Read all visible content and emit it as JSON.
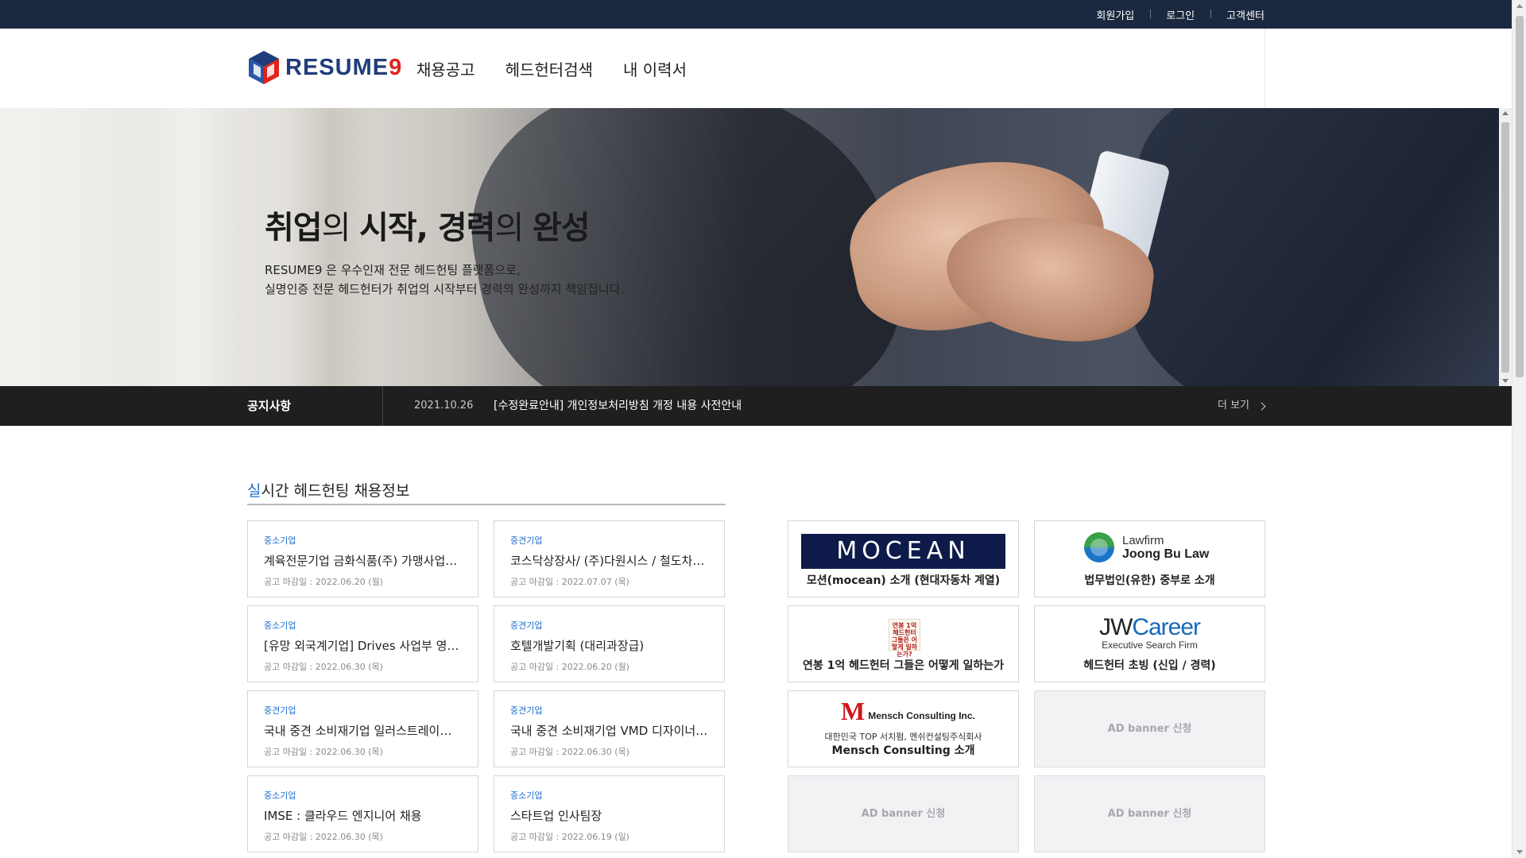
{
  "top_links": [
    "회원가입",
    "로그인",
    "고객센터"
  ],
  "logo": {
    "main": "RESUME",
    "suffix": "9"
  },
  "nav": [
    "채용공고",
    "헤드헌터검색",
    "내 이력서"
  ],
  "hero": {
    "title": {
      "part1": "취업",
      "part2": "의 ",
      "part3": "시작, 경력",
      "part4": "의 ",
      "part5": "완성"
    },
    "desc_line1": "RESUME9 은 우수인재 전문 헤드헌팅 플랫폼으로,",
    "desc_line2": "실명인증 전문 헤드헌터가 취업의 시작부터 경력의 완성까지 책임집니다."
  },
  "notice": {
    "label": "공지사항",
    "date": "2021.10.26",
    "text": "[수정완료안내] 개인정보처리방침 개정 내용 사전안내",
    "more": "더 보기"
  },
  "section": {
    "accent": "실",
    "title_rest": "시간 헤드헌팅 채용정보"
  },
  "jobs": [
    {
      "tag": "중소기업",
      "title": "계육전문기업 금화식품(주) 가맹사업부 - 가맹사업부 팀장",
      "deadline": "공고 마감일 : 2022.06.20 (월)"
    },
    {
      "tag": "중견기업",
      "title": "코스닥상장사/ (주)다원시스 / 철도차량 부문 채용",
      "deadline": "공고 마감일 : 2022.07.07 (목)"
    },
    {
      "tag": "중소기업",
      "title": "[유망 외국계기업] Drives 사업부 영업직 채용",
      "deadline": "공고 마감일 : 2022.06.30 (목)"
    },
    {
      "tag": "중견기업",
      "title": "호텔개발기획 (대리과장급)",
      "deadline": "공고 마감일 : 2022.06.20 (월)"
    },
    {
      "tag": "중견기업",
      "title": "국내 중견 소비재기업 일러스트레이터/디자이너 채용",
      "deadline": "공고 마감일 : 2022.06.30 (목)"
    },
    {
      "tag": "중견기업",
      "title": "국내 중견 소비재기업 VMD 디자이너 채용",
      "deadline": "공고 마감일 : 2022.06.30 (목)"
    },
    {
      "tag": "중소기업",
      "title": "IMSE : 클라우드 엔지니어 채용",
      "deadline": "공고 마감일 : 2022.06.30 (목)"
    },
    {
      "tag": "중소기업",
      "title": "스타트업 인사팀장",
      "deadline": "공고 마감일 : 2022.06.19 (일)"
    }
  ],
  "ads": {
    "mocean": {
      "logo": "MOCEAN",
      "caption": "모션(mocean) 소개 (현대자동차 계열)"
    },
    "lawfirm": {
      "logo_line1": "Lawfirm",
      "logo_line2": "Joong Bu Law",
      "caption": "법무법인(유한) 중부로 소개"
    },
    "book": {
      "logo_text": "연봉 1억 헤드헌터 그들은 어떻게 일하는가?",
      "caption": "연봉 1억 헤드헌터 그들은 어떻게 일하는가"
    },
    "jw": {
      "logo_jw": "JW",
      "logo_career": "Career",
      "logo_sub": "Executive Search Firm",
      "caption": "헤드헌터 초빙 (신입 / 경력)"
    },
    "mensch": {
      "logo_m": "M",
      "logo_text": "Mensch Consulting Inc.",
      "subcaption": "대한민국 TOP 서치펌, 멘쉬컨설팅주식회사",
      "caption": "Mensch Consulting 소개"
    },
    "empty_label": "AD banner 신청"
  },
  "colors": {
    "topbar": "#1b2940",
    "accent": "#1f6fd1",
    "notice_bg": "#1f1f1f",
    "logo_red": "#e2231a"
  }
}
